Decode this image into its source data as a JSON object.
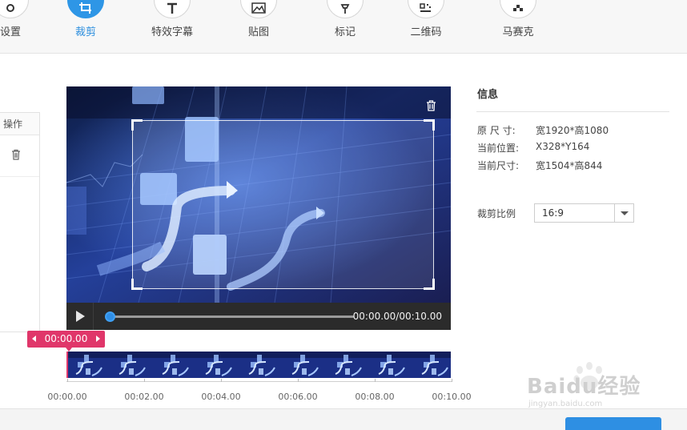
{
  "toolbar": {
    "items": [
      {
        "label": "设置",
        "icon": "settings-icon",
        "active": false
      },
      {
        "label": "裁剪",
        "icon": "crop-icon",
        "active": true
      },
      {
        "label": "特效字幕",
        "icon": "text-icon",
        "active": false
      },
      {
        "label": "贴图",
        "icon": "image-icon",
        "active": false
      },
      {
        "label": "标记",
        "icon": "pin-icon",
        "active": false
      },
      {
        "label": "二维码",
        "icon": "qrcode-icon",
        "active": false
      },
      {
        "label": "马赛克",
        "icon": "mosaic-icon",
        "active": false
      }
    ]
  },
  "left_panel": {
    "header": "操作",
    "row_icon": "trash-icon"
  },
  "video": {
    "delete_icon": "trash-icon"
  },
  "player": {
    "time": "00:00.00/00:10.00",
    "progress": 0.0
  },
  "timeline": {
    "badge": "00:00.00",
    "ticks": [
      "00:00.00",
      "00:02.00",
      "00:04.00",
      "00:06.00",
      "00:08.00",
      "00:10.00"
    ]
  },
  "info": {
    "title": "信息",
    "rows": [
      {
        "key": "原 尺 寸:",
        "value": "宽1920*高1080"
      },
      {
        "key": "当前位置:",
        "value": "X328*Y164"
      },
      {
        "key": "当前尺寸:",
        "value": "宽1504*高844"
      }
    ],
    "ratio_label": "裁剪比例",
    "ratio_value": "16:9"
  },
  "watermark": {
    "brand": "Baidu经验",
    "url": "jingyan.baidu.com"
  },
  "colors": {
    "accent": "#2e96e6",
    "marker": "#e0366a",
    "player_bg": "#2b2b2b"
  }
}
